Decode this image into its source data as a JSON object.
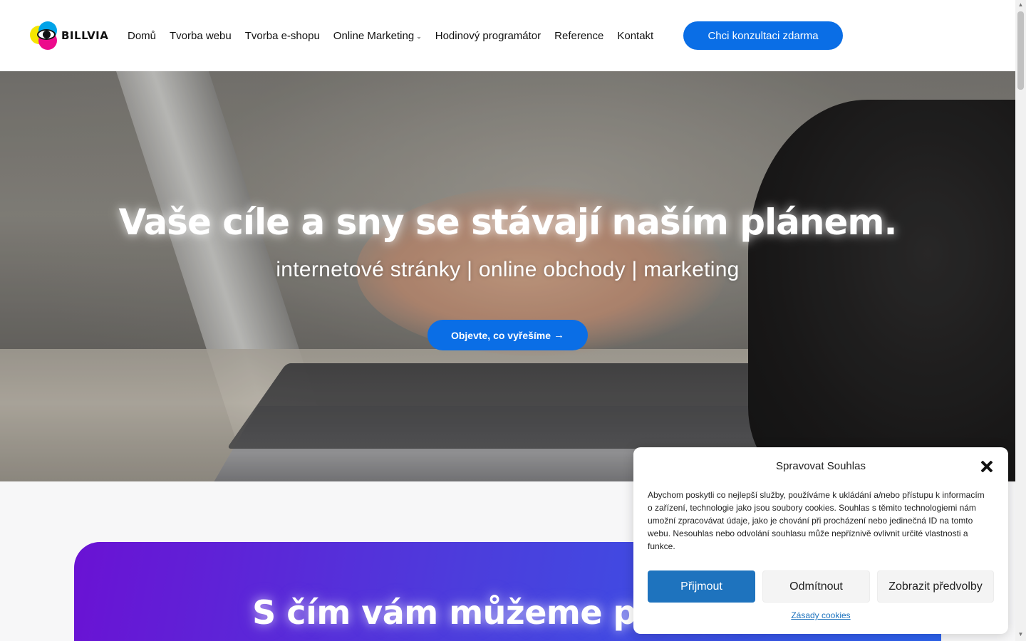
{
  "brand": {
    "name": "BILLVIA"
  },
  "nav": {
    "items": [
      {
        "label": "Domů"
      },
      {
        "label": "Tvorba webu"
      },
      {
        "label": "Tvorba e-shopu"
      },
      {
        "label": "Online Marketing"
      },
      {
        "label": "Hodinový programátor"
      },
      {
        "label": "Reference"
      },
      {
        "label": "Kontakt"
      }
    ],
    "cta_label": "Chci konzultaci zdarma"
  },
  "hero": {
    "title": "Vaše cíle a sny se stávají naším plánem.",
    "subtitle": "internetové stránky | online obchody | marketing",
    "button_label": "Objevte, co vyřešíme",
    "button_icon": "arrow-right-icon"
  },
  "services": {
    "title": "S čím vám můžeme pomoci?"
  },
  "cookie": {
    "title": "Spravovat Souhlas",
    "text": "Abychom poskytli co nejlepší služby, používáme k ukládání a/nebo přístupu k informacím o zařízení, technologie jako jsou soubory cookies. Souhlas s těmito technologiemi nám umožní zpracovávat údaje, jako je chování při procházení nebo jedinečná ID na tomto webu. Nesouhlas nebo odvolání souhlasu může nepříznivě ovlivnit určité vlastnosti a funkce.",
    "accept_label": "Přijmout",
    "deny_label": "Odmítnout",
    "prefs_label": "Zobrazit předvolby",
    "policy_link": "Zásady cookies"
  },
  "colors": {
    "accent": "#0a6ee6",
    "cookie_accept": "#1e73be",
    "gradient_start": "#6a12d4",
    "gradient_end": "#2c62ec"
  }
}
